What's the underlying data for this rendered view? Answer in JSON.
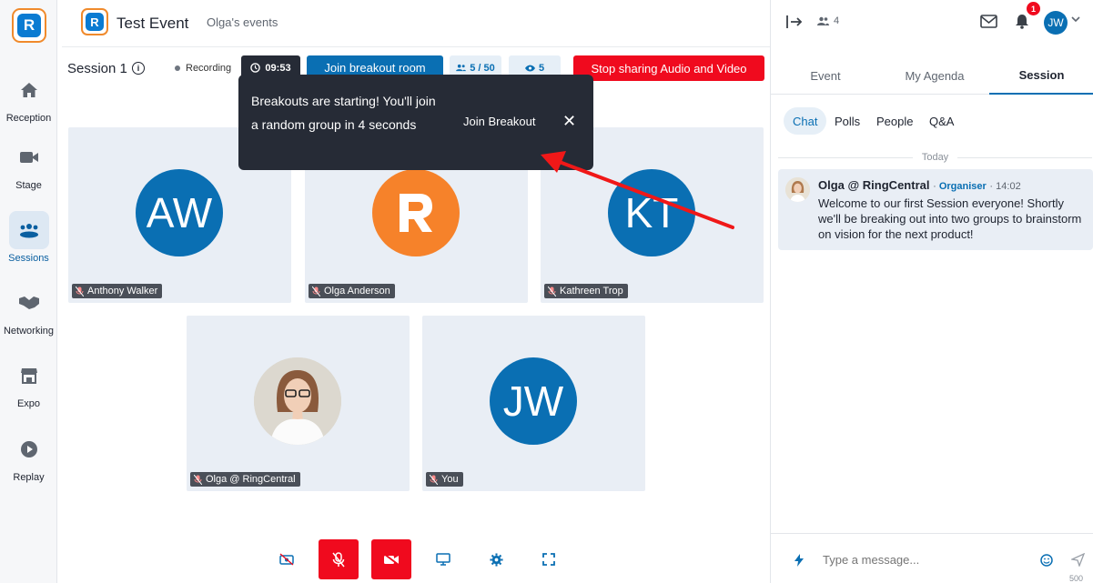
{
  "sidebar": {
    "logo": "R",
    "items": [
      {
        "label": "Reception",
        "icon": "home-icon"
      },
      {
        "label": "Stage",
        "icon": "video-camera-icon"
      },
      {
        "label": "Sessions",
        "icon": "people-group-icon"
      },
      {
        "label": "Networking",
        "icon": "handshake-icon"
      },
      {
        "label": "Expo",
        "icon": "booth-icon"
      },
      {
        "label": "Replay",
        "icon": "play-icon"
      }
    ]
  },
  "header": {
    "title": "Test Event",
    "owner_link": "Olga's events"
  },
  "session_bar": {
    "session_name": "Session 1",
    "recording_label": "Recording",
    "timer": "09:53",
    "join_room_label": "Join breakout room",
    "participants_count": "5 / 50",
    "viewers_count": "5",
    "stop_sharing_label": "Stop sharing Audio and Video"
  },
  "toast": {
    "message": "Breakouts are starting! You'll join a random group in 4 seconds",
    "action_label": "Join Breakout",
    "close_glyph": "✕"
  },
  "tiles": [
    {
      "name": "Anthony Walker",
      "initials": "AW",
      "kind": "initials"
    },
    {
      "name": "Olga Anderson",
      "initials": "R",
      "kind": "logo"
    },
    {
      "name": "Kathreen Trop",
      "initials": "KT",
      "kind": "initials"
    },
    {
      "name": "Olga @ RingCentral",
      "initials": "",
      "kind": "photo"
    },
    {
      "name": "You",
      "initials": "JW",
      "kind": "initials"
    }
  ],
  "controls": [
    "camera-off-icon",
    "mic-off-icon",
    "video-off-icon",
    "share-screen-icon",
    "settings-icon",
    "fullscreen-icon"
  ],
  "right_panel": {
    "people_count": "4",
    "notification_badge": "1",
    "user_initials": "JW",
    "tabs": [
      "Event",
      "My Agenda",
      "Session"
    ],
    "active_tab": "Session",
    "subtabs": [
      "Chat",
      "Polls",
      "People",
      "Q&A"
    ],
    "active_subtab": "Chat",
    "day_separator": "Today",
    "message": {
      "author": "Olga @ RingCentral",
      "role": "Organiser",
      "time": "14:02",
      "text": "Welcome to our first Session everyone! Shortly we'll be breaking out into two groups to brainstorm on vision for the next product!"
    },
    "composer_placeholder": "Type a message...",
    "char_limit": "500"
  },
  "colors": {
    "brand_blue": "#0a6fb3",
    "alert_red": "#f00a1e",
    "toast_bg": "#262b36",
    "tile_bg": "#e9eef5",
    "orange": "#f6822a"
  }
}
